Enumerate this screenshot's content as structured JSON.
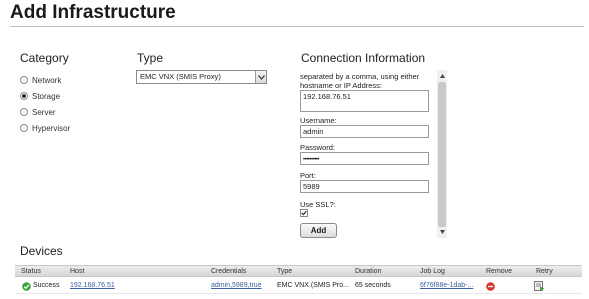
{
  "page": {
    "title": "Add Infrastructure"
  },
  "category": {
    "heading": "Category",
    "options": [
      {
        "label": "Network",
        "selected": false
      },
      {
        "label": "Storage",
        "selected": true
      },
      {
        "label": "Server",
        "selected": false
      },
      {
        "label": "Hypervisor",
        "selected": false
      }
    ]
  },
  "type": {
    "heading": "Type",
    "selected_value": "EMC VNX (SMIS Proxy)"
  },
  "connection": {
    "heading": "Connection Information",
    "instruction_line1": "separated by a comma, using either",
    "instruction_line2": "hostname or IP Address:",
    "host_value": "192.168.76.51",
    "username_label": "Username:",
    "username_value": "admin",
    "password_label": "Password:",
    "password_value": "••••••••••",
    "port_label": "Port:",
    "port_value": "5989",
    "ssl_label": "Use SSL?:",
    "ssl_checked": true,
    "add_button": "Add"
  },
  "devices": {
    "heading": "Devices",
    "columns": [
      "Status",
      "Host",
      "Credentials",
      "Type",
      "Duration",
      "Job Log",
      "Remove",
      "Retry"
    ],
    "rows": [
      {
        "status": "Success",
        "host": "192.168.76.51",
        "credentials": "admin,5989,true",
        "type": "EMC VNX (SMIS Pro...",
        "duration": "65 seconds",
        "job_log": "6f76f88e-1dab-..."
      }
    ]
  },
  "colors": {
    "success": "#3aa335",
    "remove": "#d9342b",
    "link": "#3a5fa0"
  }
}
